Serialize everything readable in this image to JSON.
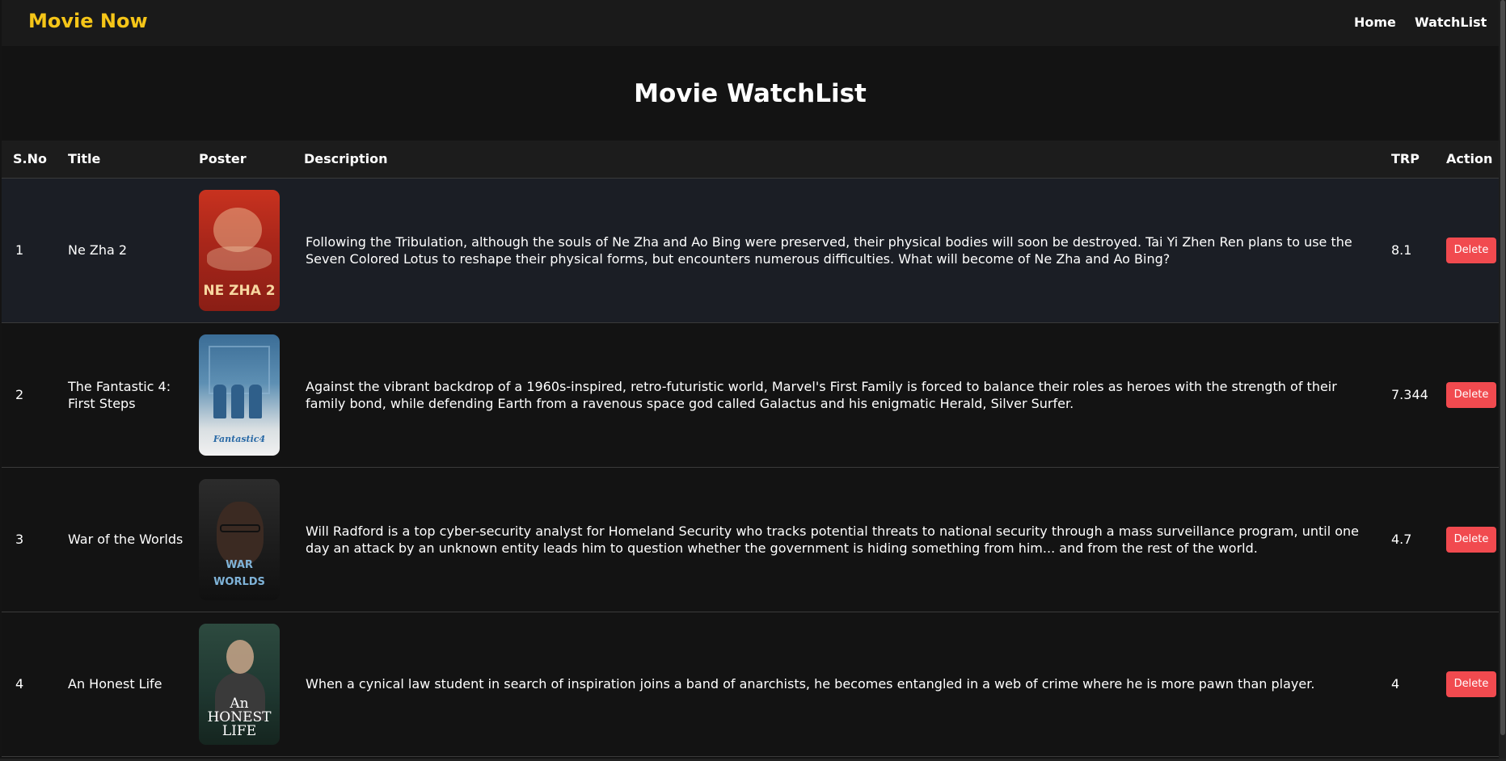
{
  "navbar": {
    "brand": "Movie Now",
    "links": {
      "home": "Home",
      "watchlist": "WatchList"
    }
  },
  "page": {
    "title": "Movie WatchList"
  },
  "table": {
    "headers": {
      "sno": "S.No",
      "title": "Title",
      "poster": "Poster",
      "description": "Description",
      "trp": "TRP",
      "action": "Action"
    },
    "rows": [
      {
        "sno": "1",
        "title": "Ne Zha 2",
        "poster_text": "NE ZHA 2",
        "description": "Following the Tribulation, although the souls of Ne Zha and Ao Bing were preserved, their physical bodies will soon be destroyed. Tai Yi Zhen Ren plans to use the Seven Colored Lotus to reshape their physical forms, but encounters numerous difficulties. What will become of Ne Zha and Ao Bing?",
        "trp": "8.1",
        "action": "Delete"
      },
      {
        "sno": "2",
        "title": "The Fantastic 4: First Steps",
        "poster_text": "Fantastic4",
        "description": "Against the vibrant backdrop of a 1960s-inspired, retro-futuristic world, Marvel's First Family is forced to balance their roles as heroes with the strength of their family bond, while defending Earth from a ravenous space god called Galactus and his enigmatic Herald, Silver Surfer.",
        "trp": "7.344",
        "action": "Delete"
      },
      {
        "sno": "3",
        "title": "War of the Worlds",
        "poster_text": "WAR WORLDS",
        "description": "Will Radford is a top cyber-security analyst for Homeland Security who tracks potential threats to national security through a mass surveillance program, until one day an attack by an unknown entity leads him to question whether the government is hiding something from him... and from the rest of the world.",
        "trp": "4.7",
        "action": "Delete"
      },
      {
        "sno": "4",
        "title": "An Honest Life",
        "poster_text": "An HONEST LIFE",
        "description": "When a cynical law student in search of inspiration joins a band of anarchists, he becomes entangled in a web of crime where he is more pawn than player.",
        "trp": "4",
        "action": "Delete"
      }
    ]
  },
  "colors": {
    "brand": "#f5c518",
    "background": "#131313",
    "navbar": "#1a1a1a",
    "delete_button": "#f14a4f",
    "hover_row": "#1b1e25"
  }
}
